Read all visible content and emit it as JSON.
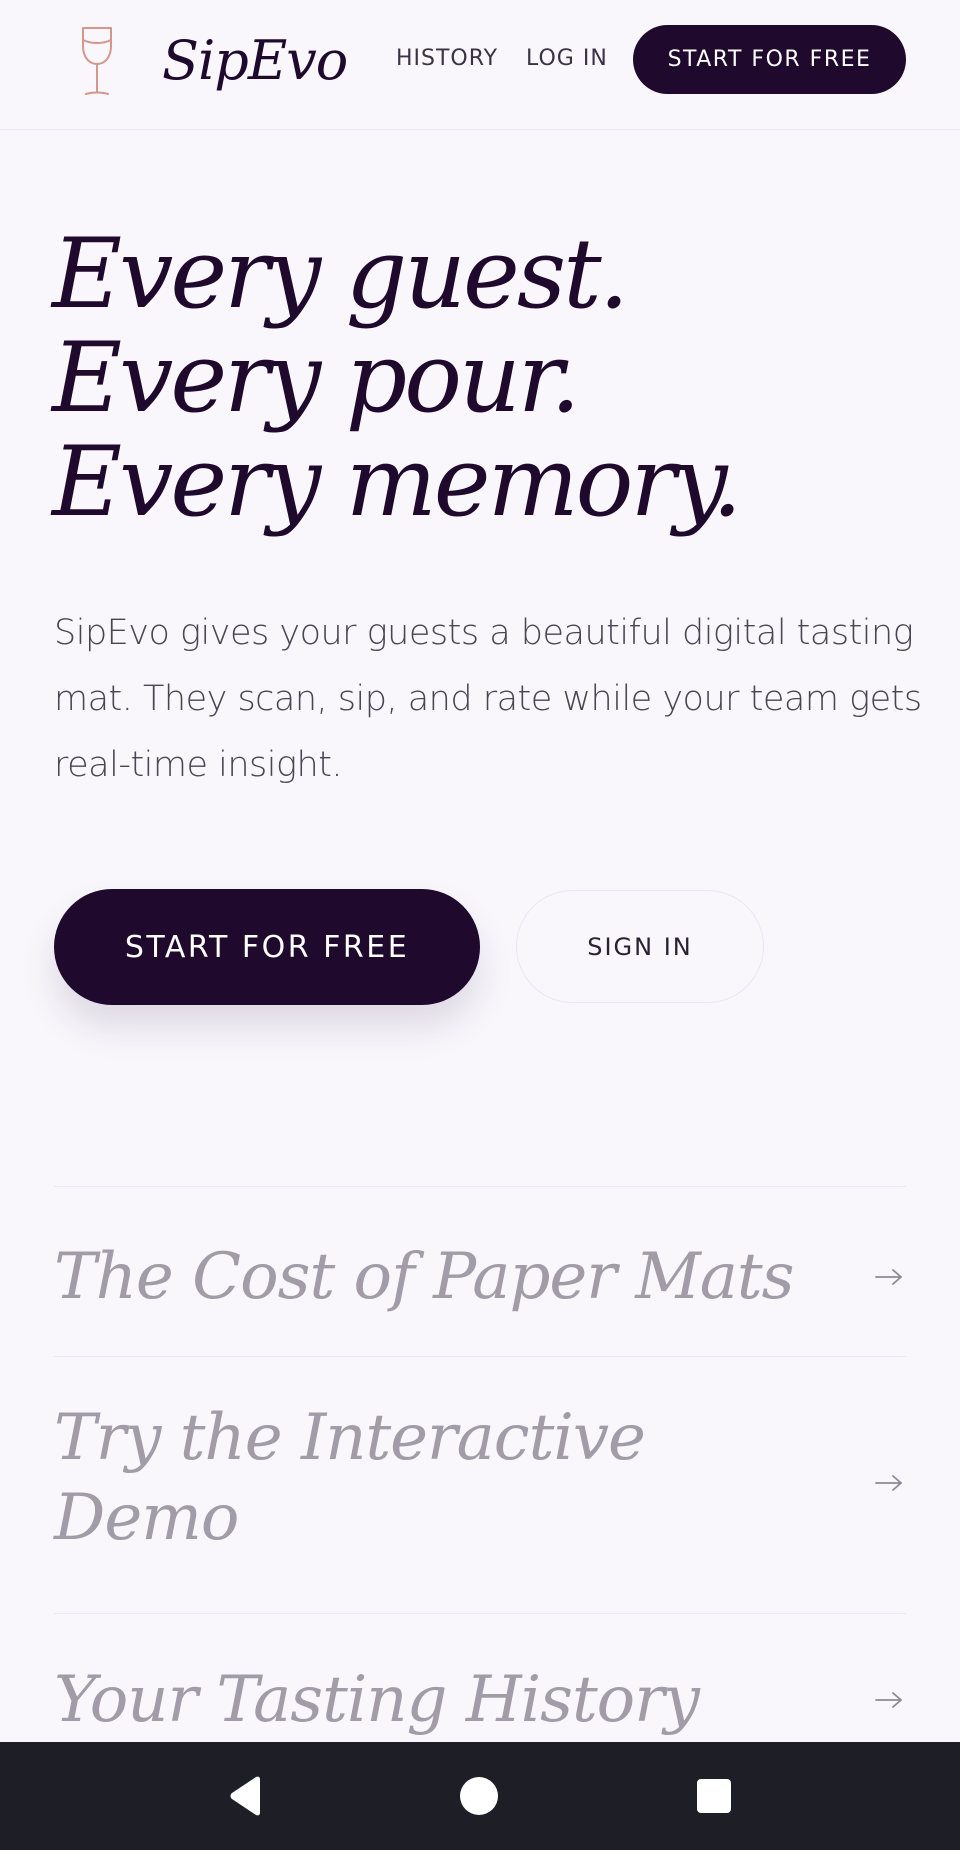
{
  "header": {
    "brand": "SipEvo",
    "logo_icon": "wine-glass-icon",
    "nav": {
      "history": "HISTORY",
      "login": "LOG IN",
      "cta": "START FOR FREE"
    }
  },
  "hero": {
    "title_lines": [
      "Every guest.",
      "Every pour.",
      "Every memory."
    ],
    "description": "SipEvo gives your guests a beautiful digital tasting mat. They scan, sip, and rate while your team gets real-time insight.",
    "primary_button": "START FOR FREE",
    "secondary_button": "SIGN IN"
  },
  "features": [
    {
      "title": "The Cost of Paper Mats",
      "icon": "arrow-right-icon"
    },
    {
      "title": "Try the Interactive Demo",
      "icon": "arrow-right-icon"
    },
    {
      "title": "Your Tasting History",
      "icon": "arrow-right-icon"
    }
  ],
  "system_nav": {
    "icons": [
      "back-icon",
      "home-icon",
      "recents-icon"
    ]
  },
  "colors": {
    "background": "#f9f7fc",
    "primary": "#1f0a2e",
    "muted_text": "#a19ca7",
    "logo_accent": "#d4978a",
    "system_bar": "#1e1f26"
  }
}
